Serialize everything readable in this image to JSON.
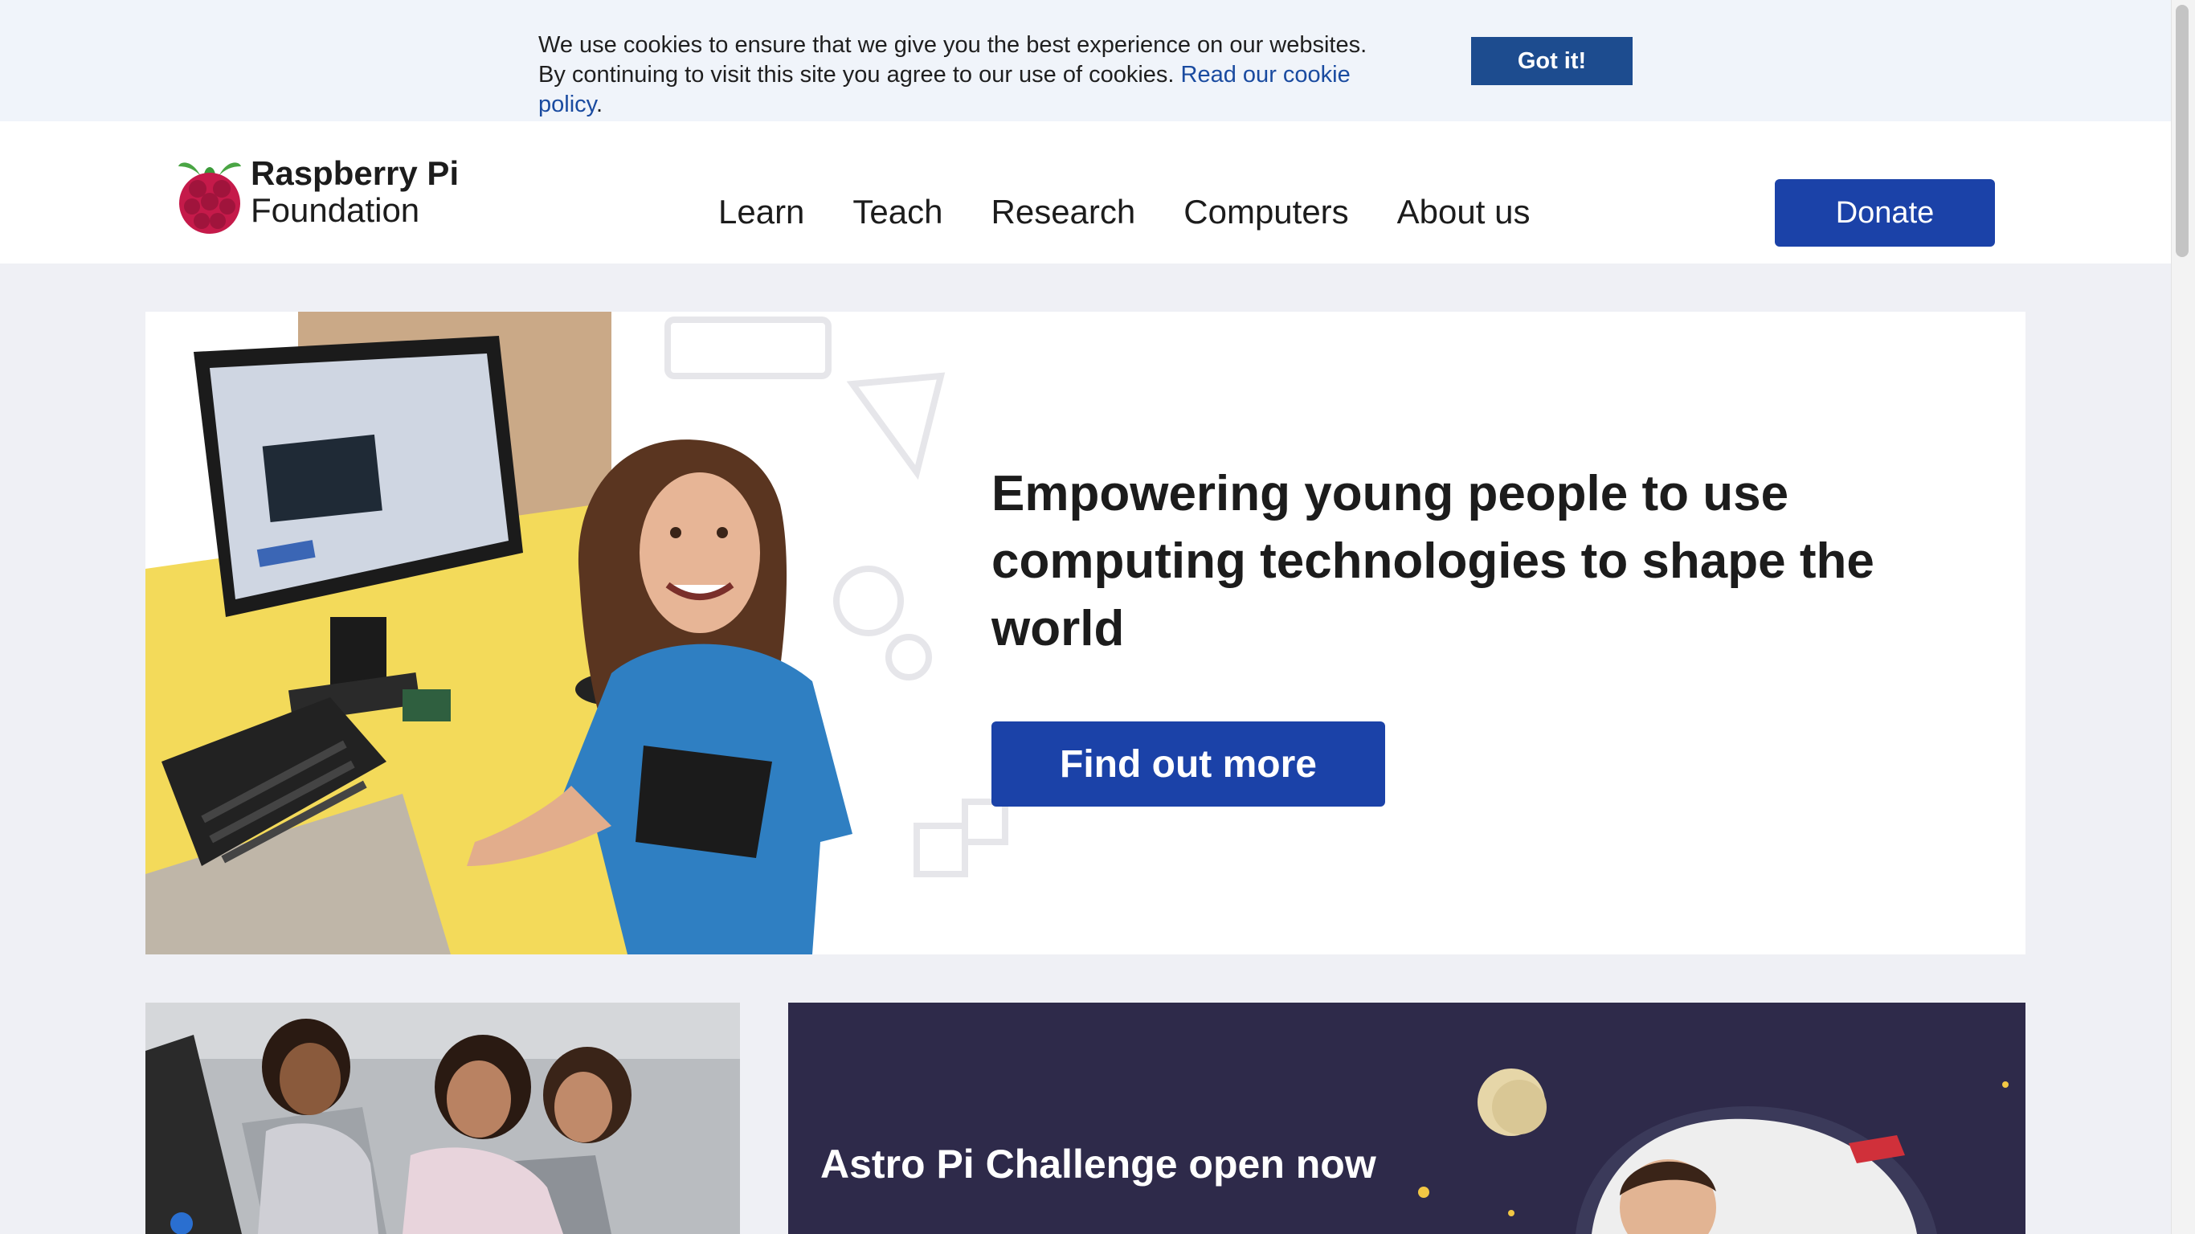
{
  "cookie_banner": {
    "text": "We use cookies to ensure that we give you the best experience on our websites. By continuing to visit this site you agree to our use of cookies. ",
    "link_text": "Read our cookie policy",
    "suffix": ".",
    "button_label": "Got it!"
  },
  "header": {
    "brand_line1": "Raspberry Pi",
    "brand_line2": "Foundation",
    "nav": [
      "Learn",
      "Teach",
      "Research",
      "Computers",
      "About us"
    ],
    "donate_label": "Donate"
  },
  "hero": {
    "title": "Empowering young people to use computing technologies to shape the world",
    "button_label": "Find out more"
  },
  "astro_card": {
    "title": "Astro Pi Challenge open now"
  },
  "colors": {
    "primary": "#1b42a8",
    "cookie_button": "#1d4c8f",
    "link": "#1a4ba0",
    "astro_bg": "#2e2a4a",
    "page_bg": "#eff0f5"
  },
  "icons": [
    "raspberry-logo-icon"
  ]
}
